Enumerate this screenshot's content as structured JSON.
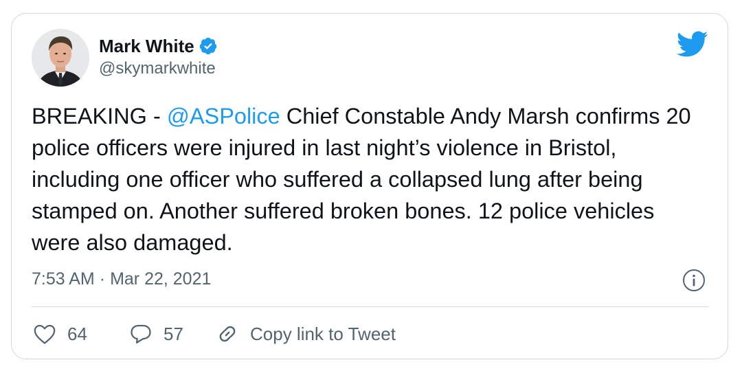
{
  "author": {
    "display_name": "Mark White",
    "handle": "@skymarkwhite",
    "verified": true
  },
  "tweet": {
    "text_before": "BREAKING - ",
    "mention": "@ASPolice",
    "text_after": " Chief Constable Andy Marsh confirms 20 police officers were injured in last night’s violence in Bristol, including one officer who suffered a collapsed lung after being stamped on. Another suffered broken bones. 12 police vehicles were also damaged."
  },
  "meta": {
    "time": "7:53 AM",
    "separator": "·",
    "date": "Mar 22, 2021"
  },
  "actions": {
    "likes": "64",
    "replies": "57",
    "copy_link_label": "Copy link to Tweet"
  },
  "colors": {
    "twitter_blue": "#1d9bf0",
    "text": "#0f1419",
    "secondary": "#536471",
    "border": "#cfd9de"
  },
  "icons": [
    "verified-badge-icon",
    "twitter-bird-icon",
    "info-icon",
    "heart-icon",
    "reply-bubble-icon",
    "link-icon"
  ]
}
